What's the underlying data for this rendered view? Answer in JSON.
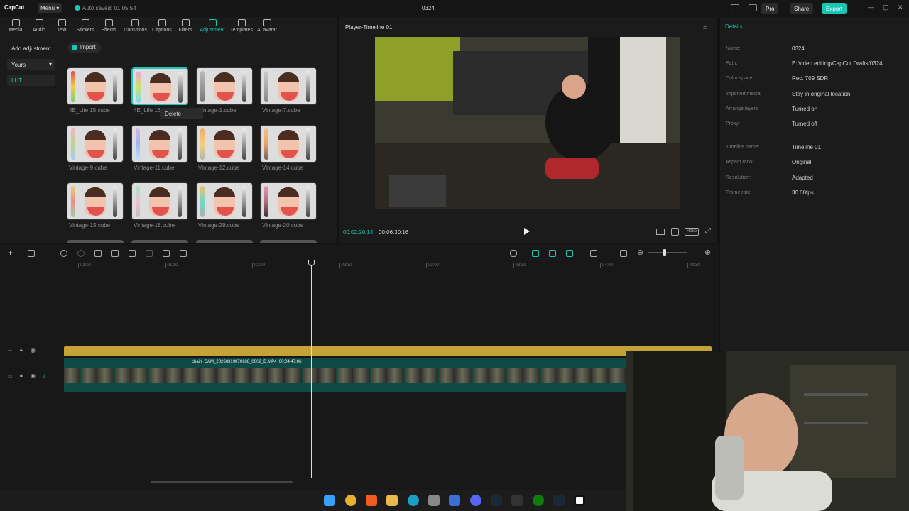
{
  "titlebar": {
    "app_name": "CapCut",
    "menu_label": "Menu",
    "autosave": "Auto saved: 01:05:54",
    "project": "0324",
    "pro": "Pro",
    "share": "Share",
    "export": "Export"
  },
  "tools": [
    "Media",
    "Audio",
    "Text",
    "Stickers",
    "Effects",
    "Transitions",
    "Captions",
    "Filters",
    "Adjustment",
    "Templates",
    "AI avatar"
  ],
  "active_tool": "Adjustment",
  "sidebar": {
    "add_adjustment": "Add adjustment",
    "yours": "Yours",
    "lut": "LUT"
  },
  "library": {
    "import": "Import",
    "context_menu": "Delete",
    "items": [
      "4E_Life 15.cube",
      "4E_Life 16.cube",
      "Vintage-1.cube",
      "Vintage-7.cube",
      "Vintage-9.cube",
      "Vintage-11.cube",
      "Vintage-12.cube",
      "Vintage-14.cube",
      "Vintage-15.cube",
      "Vintage-18.cube",
      "Vintage-29.cube",
      "Vintage-20.cube"
    ]
  },
  "player": {
    "title": "Player-Timeline 01",
    "current_time": "00:02:20:14",
    "total_time": "00:06:30:16",
    "ratio": "Ratio"
  },
  "details": {
    "title": "Details",
    "rows": [
      {
        "k": "Name:",
        "v": "0324"
      },
      {
        "k": "Path:",
        "v": "E:/video editing/CapCut Drafts/0324"
      },
      {
        "k": "Color space",
        "v": "Rec. 709 SDR"
      },
      {
        "k": "Imported media:",
        "v": "Stay in original location"
      },
      {
        "k": "Arrange layers",
        "v": "Turned on"
      },
      {
        "k": "Proxy:",
        "v": "Turned off"
      },
      {
        "k": "Timeline name:",
        "v": "Timeline 01"
      },
      {
        "k": "Aspect ratio:",
        "v": "Original"
      },
      {
        "k": "Resolution:",
        "v": "Adapted"
      },
      {
        "k": "Frame rate:",
        "v": "30.00fps"
      }
    ]
  },
  "timeline": {
    "ruler": [
      "01:00",
      "01:30",
      "02:00",
      "02:30",
      "03:00",
      "03:30",
      "04:00",
      "04:30"
    ],
    "clip_prefix": "chain",
    "clip_name": "CAM_20260319070108_0002_D.MP4",
    "clip_duration": "00:04:47:06"
  },
  "colors": {
    "accent": "#19c6b4",
    "gold": "#c4a238",
    "track": "#0e4b45"
  }
}
